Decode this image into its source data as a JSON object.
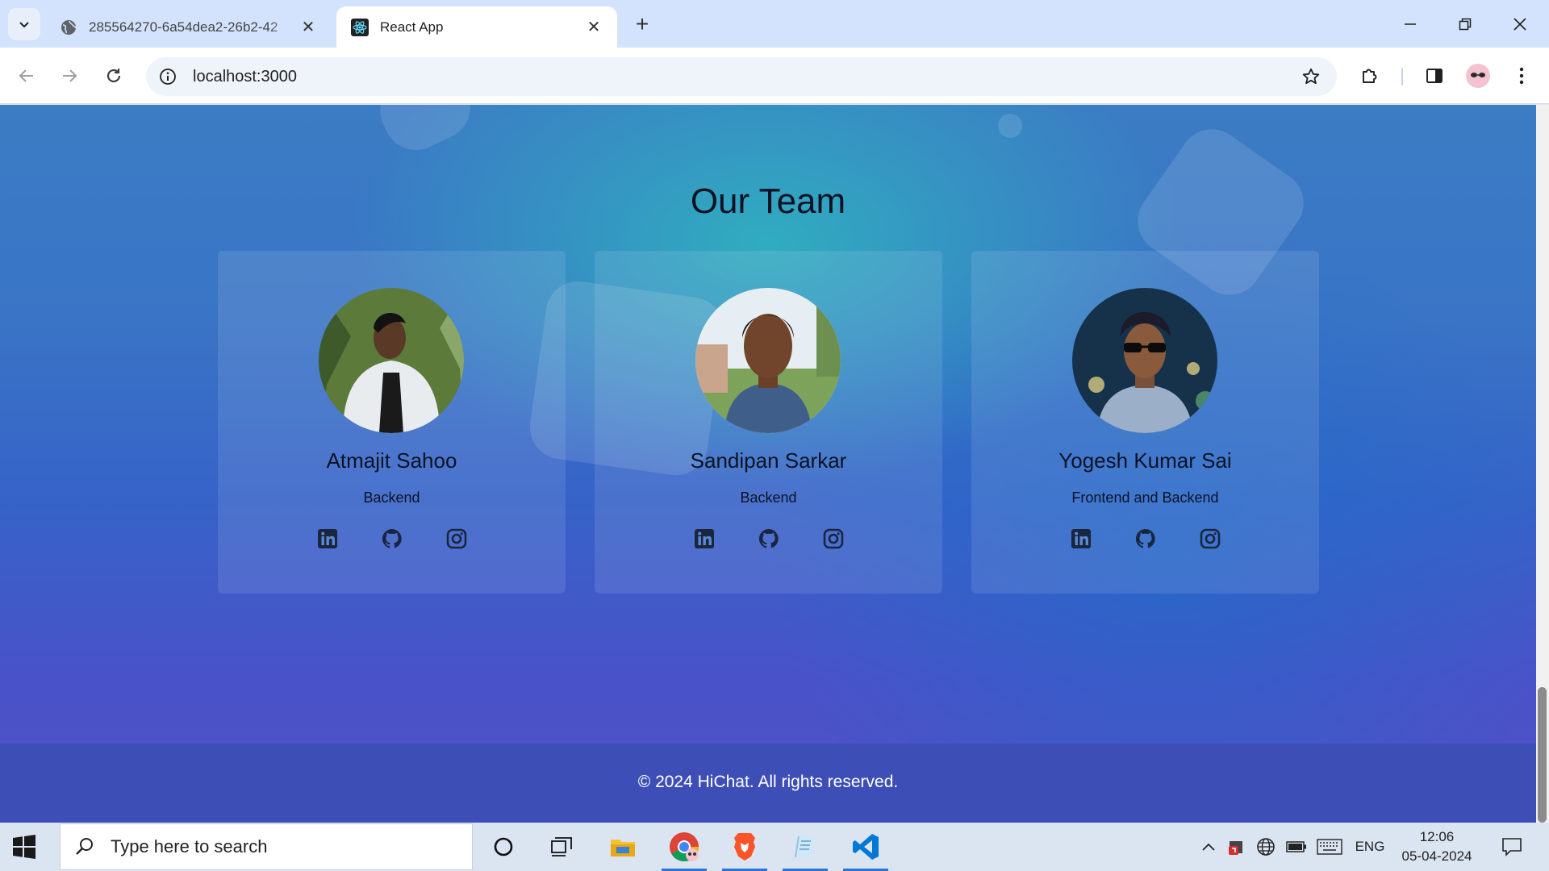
{
  "browser": {
    "tabs": [
      {
        "title": "285564270-6a54dea2-26b2-42",
        "active": false
      },
      {
        "title": "React App",
        "active": true
      }
    ],
    "url": "localhost:3000"
  },
  "page": {
    "section_title": "Our Team",
    "team": [
      {
        "name": "Atmajit Sahoo",
        "role": "Backend",
        "socials": [
          "linkedin-icon",
          "github-icon",
          "instagram-icon"
        ]
      },
      {
        "name": "Sandipan Sarkar",
        "role": "Backend",
        "socials": [
          "linkedin-icon",
          "github-icon",
          "instagram-icon"
        ]
      },
      {
        "name": "Yogesh Kumar Sai",
        "role": "Frontend and Backend",
        "socials": [
          "linkedin-icon",
          "github-icon",
          "instagram-icon"
        ]
      }
    ],
    "footer": "© 2024 HiChat. All rights reserved.",
    "colors": {
      "background_top": "#3b7cc4",
      "background_bottom": "#4e51c6",
      "footer": "#3d4fb7"
    }
  },
  "taskbar": {
    "search_placeholder": "Type here to search",
    "language": "ENG",
    "time": "12:06",
    "date": "05-04-2024"
  }
}
